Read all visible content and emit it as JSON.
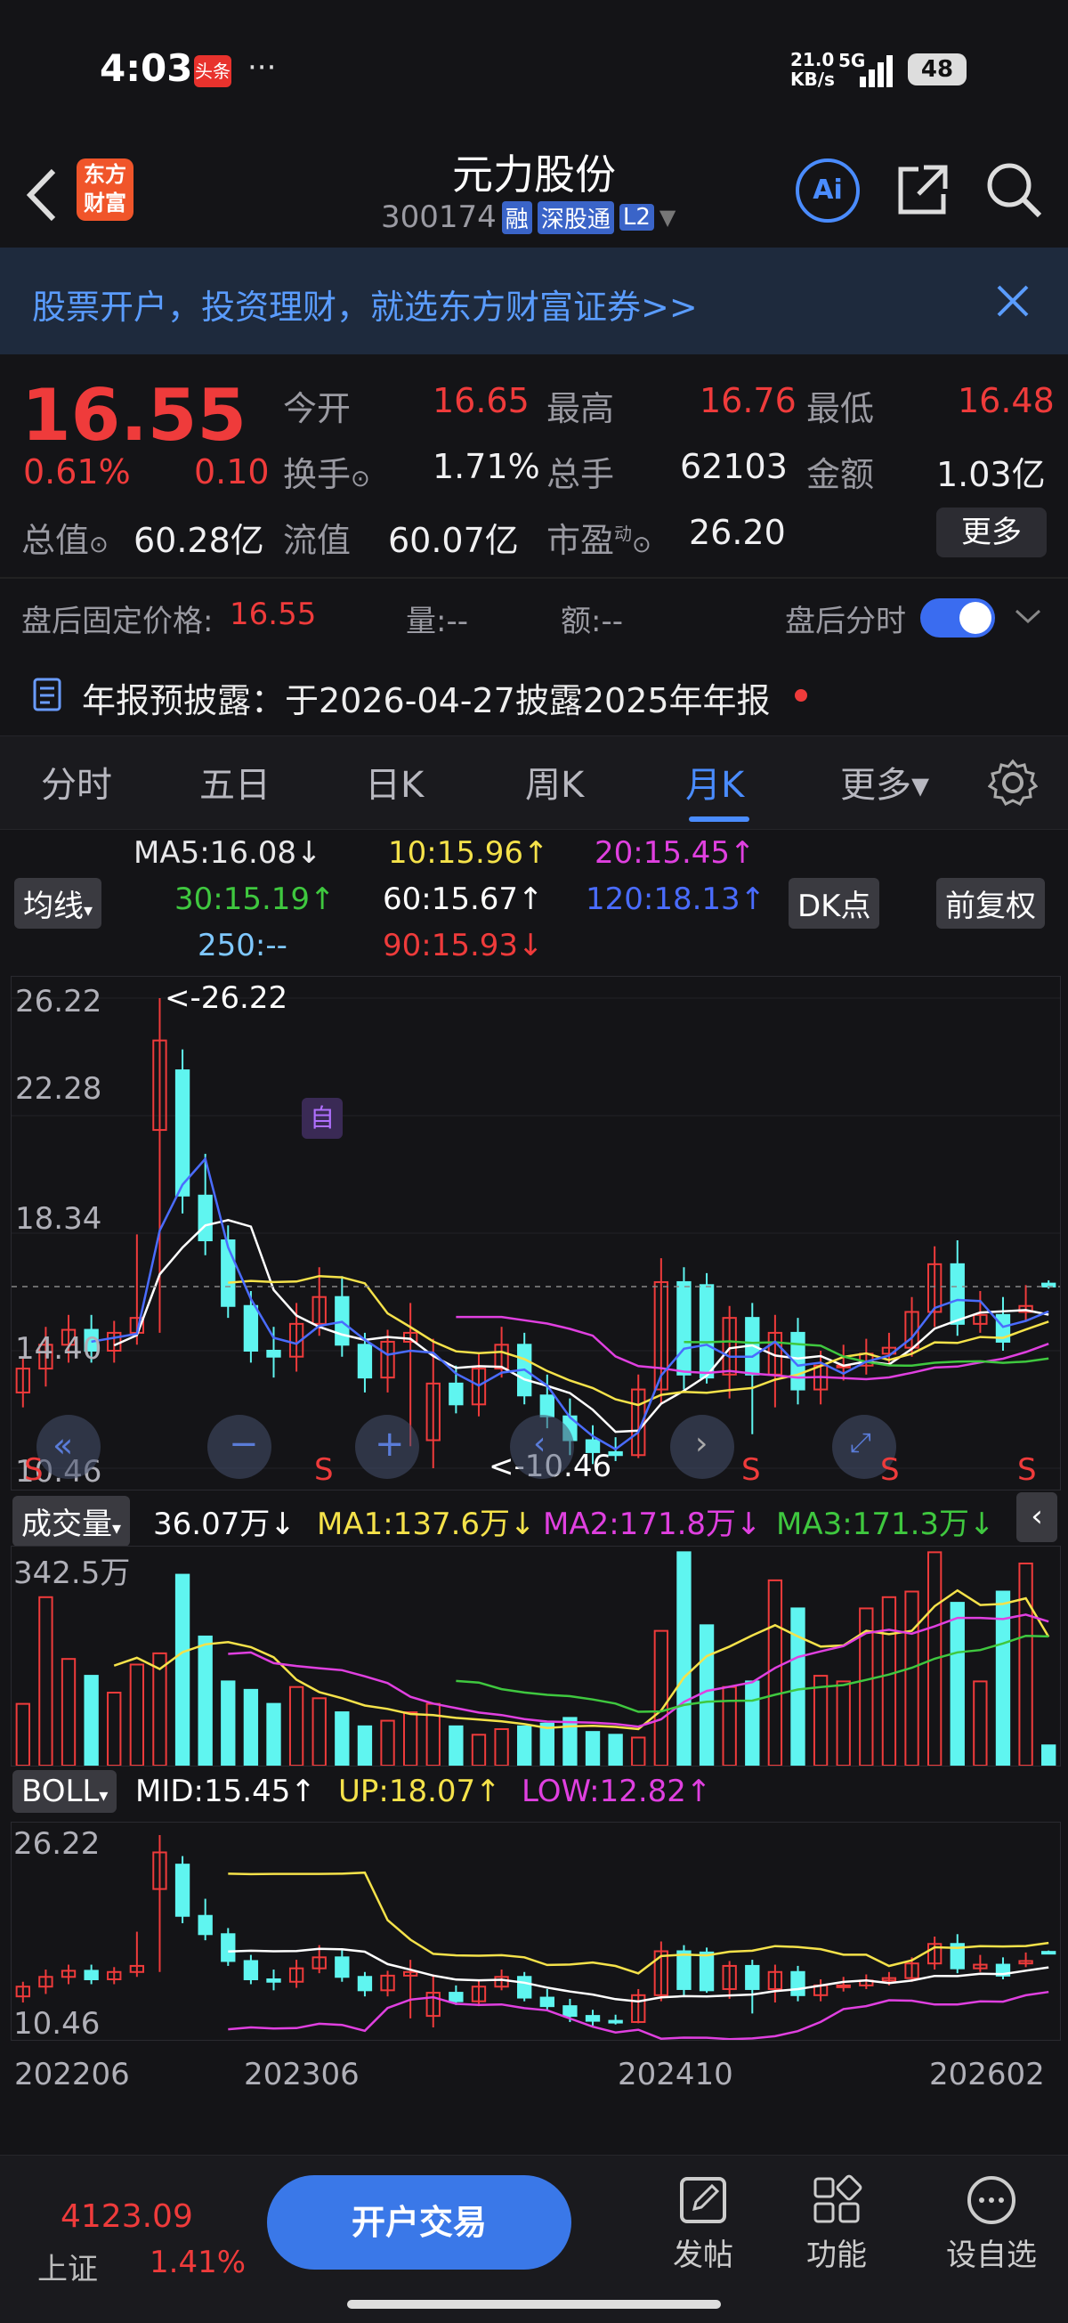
{
  "status": {
    "time": "4:03",
    "app_badge": "头条",
    "dots": "···",
    "net_speed": "21.0",
    "net_unit": "KB/s",
    "net_type": "5G",
    "battery": "48"
  },
  "header": {
    "title": "元力股份",
    "code": "300174",
    "tag_rong": "融",
    "tag_sgt": "深股通",
    "tag_l2": "L2",
    "logo_line1": "东方",
    "logo_line2": "财富",
    "ai_label": "Ai"
  },
  "banner": {
    "text": "股票开户，投资理财，就选东方财富证券>>"
  },
  "quote": {
    "price": "16.55",
    "pct": "0.61%",
    "chg": "0.10",
    "open_label": "今开",
    "open": "16.65",
    "high_label": "最高",
    "high": "16.76",
    "low_label": "最低",
    "low": "16.48",
    "turnover_label": "换手",
    "turnover": "1.71%",
    "vol_label": "总手",
    "vol": "62103",
    "amount_label": "金额",
    "amount": "1.03亿",
    "mktcap_label": "总值",
    "mktcap": "60.28亿",
    "float_label": "流值",
    "float": "60.07亿",
    "pe_label": "市盈",
    "pe_sup": "动",
    "pe": "26.20",
    "more_label": "更多"
  },
  "afterhours": {
    "label": "盘后固定价格:",
    "price": "16.55",
    "qty_label": "量:",
    "qty": "--",
    "amt_label": "额:",
    "amt": "--",
    "toggle_label": "盘后分时",
    "toggle_on": true
  },
  "notice": {
    "text": "年报预披露：于2026-04-27披露2025年年报"
  },
  "tabs": [
    "分时",
    "五日",
    "日K",
    "周K",
    "月K",
    "更多▾"
  ],
  "active_tab": 4,
  "ma_panel": {
    "selector": "均线",
    "ma5": "MA5:16.08↓",
    "ma10": "10:15.96↑",
    "ma20": "20:15.45↑",
    "ma30": "30:15.19↑",
    "ma60": "60:15.67↑",
    "ma120": "120:18.13↑",
    "ma250": "250:--",
    "ma90": "90:15.93↓",
    "dk_btn": "DK点",
    "fq_btn": "前复权",
    "colors": {
      "ma5": "#ffffff",
      "ma10": "#f5e24a",
      "ma20": "#e040e0",
      "ma30": "#3fc83f",
      "ma60": "#ffffff",
      "ma120": "#4a6cff",
      "ma250": "#7fc8ff",
      "ma90": "#ef3b3b"
    }
  },
  "kline": {
    "y_labels": [
      "26.22",
      "22.28",
      "18.34",
      "14.40",
      "10.46"
    ],
    "max_label": "<-26.22",
    "min_label": "<-10.46",
    "marker": "自",
    "s_label": "S"
  },
  "volume_panel": {
    "selector": "成交量",
    "value": "36.07万↓",
    "ma1": "MA1:137.6万↓",
    "ma2": "MA2:171.8万↓",
    "ma3": "MA3:171.3万↓",
    "y_label": "342.5万"
  },
  "boll_panel": {
    "selector": "BOLL",
    "mid": "MID:15.45↑",
    "up": "UP:18.07↑",
    "low": "LOW:12.82↑",
    "y_top": "26.22",
    "y_bottom": "10.46"
  },
  "x_axis": [
    "202206",
    "202306",
    "202410",
    "202602"
  ],
  "bottom": {
    "index_value": "4123.09",
    "index_name": "上证",
    "index_pct": "1.41%",
    "trade_btn": "开户交易",
    "nav": [
      {
        "label": "发帖",
        "icon": "edit-icon"
      },
      {
        "label": "功能",
        "icon": "grid-icon"
      },
      {
        "label": "设自选",
        "icon": "more-circle-icon"
      }
    ]
  },
  "chart_data": {
    "type": "candlestick",
    "x": [
      "202206",
      "202207",
      "202208",
      "202209",
      "202210",
      "202211",
      "202212",
      "202301",
      "202302",
      "202303",
      "202304",
      "202305",
      "202306",
      "202307",
      "202308",
      "202309",
      "202310",
      "202311",
      "202312",
      "202401",
      "202402",
      "202403",
      "202404",
      "202405",
      "202406",
      "202407",
      "202408",
      "202409",
      "202410",
      "202411",
      "202412",
      "202501",
      "202502",
      "202503",
      "202504",
      "202505",
      "202506",
      "202507",
      "202508",
      "202509",
      "202510",
      "202511",
      "202512",
      "202601",
      "202602",
      "202603"
    ],
    "open": [
      13.0,
      13.8,
      14.6,
      15.1,
      14.4,
      15.0,
      21.8,
      23.8,
      19.6,
      18.1,
      15.9,
      14.4,
      14.2,
      15.3,
      16.2,
      14.6,
      13.5,
      14.7,
      11.4,
      13.3,
      12.6,
      13.8,
      14.6,
      12.9,
      12.2,
      11.4,
      11.0,
      10.9,
      13.1,
      16.7,
      16.6,
      13.6,
      15.5,
      13.6,
      15.0,
      13.1,
      13.9,
      13.9,
      14.3,
      14.5,
      15.7,
      17.3,
      15.3,
      15.6,
      15.7,
      16.65
    ],
    "close": [
      13.8,
      14.6,
      15.1,
      14.4,
      15.0,
      15.5,
      24.8,
      19.6,
      18.1,
      15.9,
      14.4,
      14.2,
      15.3,
      16.2,
      14.6,
      13.5,
      14.7,
      15.0,
      13.3,
      12.6,
      13.8,
      14.6,
      12.9,
      12.2,
      11.4,
      11.0,
      10.9,
      13.1,
      16.7,
      13.6,
      13.5,
      15.5,
      13.6,
      15.0,
      13.1,
      13.9,
      13.9,
      14.3,
      14.5,
      15.7,
      17.3,
      15.3,
      15.6,
      14.7,
      15.9,
      16.55
    ],
    "high": [
      14.2,
      15.2,
      15.6,
      15.6,
      15.4,
      18.3,
      26.22,
      24.5,
      21.0,
      18.6,
      16.4,
      15.2,
      16.0,
      17.2,
      16.9,
      15.0,
      15.1,
      16.0,
      14.8,
      13.9,
      14.3,
      15.2,
      15.0,
      13.6,
      12.8,
      11.9,
      11.5,
      13.6,
      17.5,
      17.2,
      17.0,
      15.9,
      16.0,
      15.6,
      15.5,
      14.4,
      14.6,
      14.8,
      15.0,
      16.2,
      17.9,
      18.1,
      16.4,
      16.2,
      16.6,
      16.76
    ],
    "low": [
      12.5,
      13.2,
      14.0,
      14.0,
      14.0,
      14.6,
      15.0,
      19.0,
      17.6,
      15.5,
      14.0,
      13.5,
      13.7,
      14.9,
      14.2,
      13.0,
      13.0,
      11.2,
      10.46,
      12.3,
      12.2,
      13.5,
      12.6,
      11.8,
      10.9,
      10.6,
      10.7,
      10.8,
      12.6,
      13.1,
      13.3,
      12.8,
      11.6,
      12.5,
      12.6,
      12.6,
      13.4,
      13.6,
      13.9,
      14.2,
      15.2,
      14.9,
      15.0,
      14.4,
      15.4,
      16.48
    ],
    "volume_wan": [
      110,
      300,
      190,
      160,
      130,
      180,
      200,
      340,
      230,
      150,
      135,
      110,
      140,
      120,
      95,
      70,
      80,
      95,
      110,
      70,
      55,
      65,
      70,
      75,
      85,
      60,
      55,
      50,
      240,
      380,
      250,
      140,
      150,
      330,
      280,
      160,
      150,
      280,
      300,
      310,
      380,
      290,
      150,
      310,
      360,
      36.07
    ],
    "ylim": [
      10.46,
      26.22
    ]
  }
}
